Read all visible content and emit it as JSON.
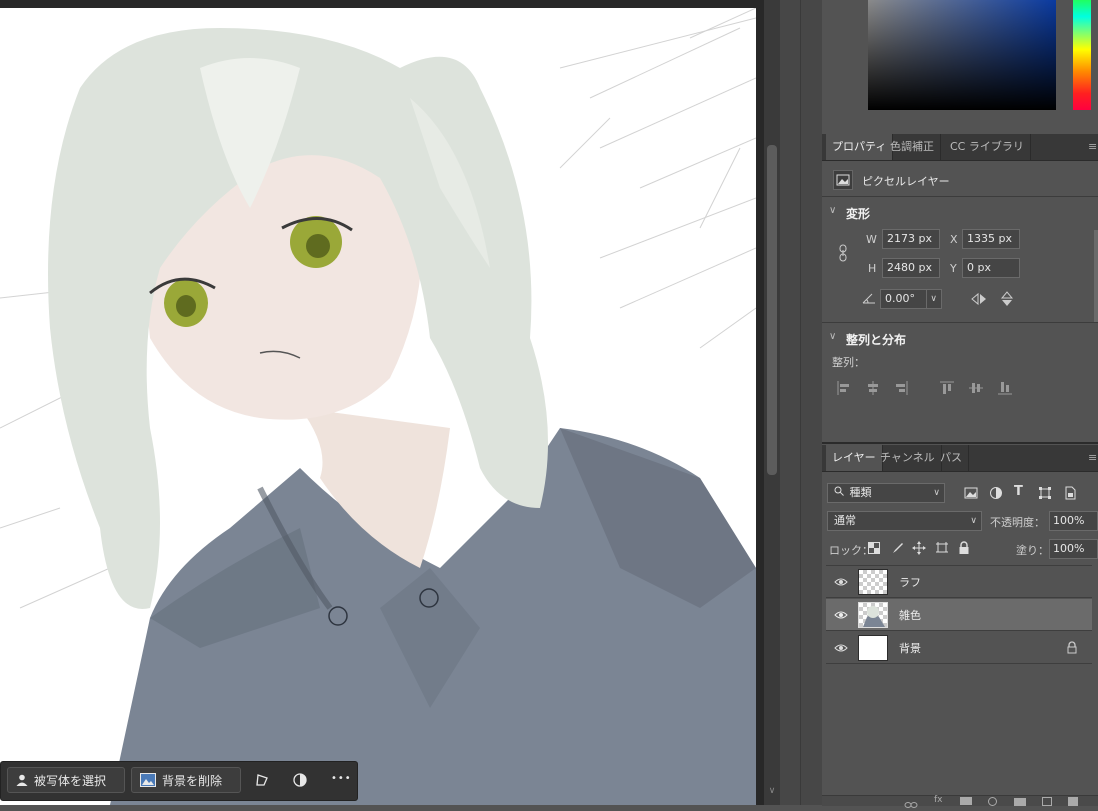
{
  "taskbar": {
    "select_subject": "被写体を選択",
    "remove_background": "背景を削除",
    "more": "•••"
  },
  "properties": {
    "tabs": [
      "プロパティ",
      "色調補正",
      "CC ライブラリ"
    ],
    "layer_type": "ピクセルレイヤー",
    "transform": {
      "title": "変形",
      "w_label": "W",
      "w_value": "2173 px",
      "x_label": "X",
      "x_value": "1335 px",
      "h_label": "H",
      "h_value": "2480 px",
      "y_label": "Y",
      "y_value": "0 px",
      "angle_value": "0.00°"
    },
    "align": {
      "title": "整列と分布",
      "label": "整列："
    }
  },
  "layers": {
    "tabs": [
      "レイヤー",
      "チャンネル",
      "パス"
    ],
    "filter": "種類",
    "blend_mode": "通常",
    "opacity_label": "不透明度：",
    "opacity_value": "100%",
    "lock_label": "ロック：",
    "fill_label": "塗り：",
    "fill_value": "100%",
    "items": [
      {
        "name": "ラフ",
        "selected": false
      },
      {
        "name": "雑色",
        "selected": true
      },
      {
        "name": "背景",
        "selected": false,
        "locked": true
      }
    ]
  },
  "colors": {
    "panel": "#535353",
    "selected_layer": "#6b6b6b",
    "hoodie": "#7b8594",
    "hair": "#dde3dc",
    "eyes": "#9aa838"
  }
}
